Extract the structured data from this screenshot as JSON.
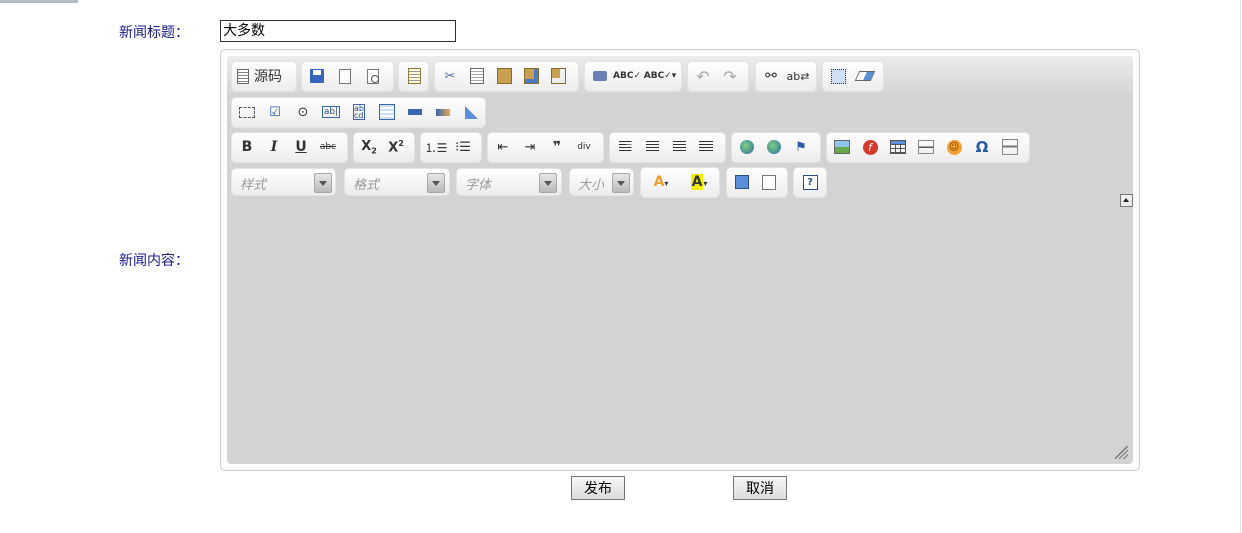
{
  "form": {
    "title_label": "新闻标题：",
    "title_value": "大多数",
    "content_label": "新闻内容："
  },
  "toolbar": {
    "source_label": "源码",
    "combos": {
      "style": "样式",
      "format": "格式",
      "font": "字体",
      "size": "大小"
    }
  },
  "buttons": {
    "publish": "发布",
    "cancel": "取消"
  }
}
